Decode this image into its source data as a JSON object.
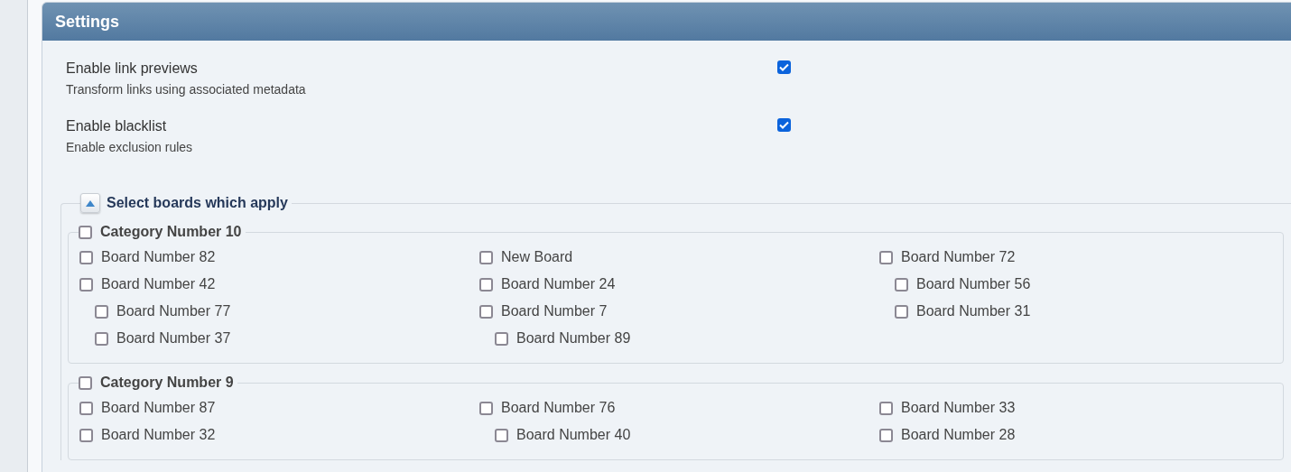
{
  "panel": {
    "title": "Settings"
  },
  "options": [
    {
      "label": "Enable link previews",
      "description": "Transform links using associated metadata",
      "checked": true
    },
    {
      "label": "Enable blacklist",
      "description": "Enable exclusion rules",
      "checked": true
    }
  ],
  "board_selector": {
    "title": "Select boards which apply",
    "expanded": true,
    "categories": [
      {
        "label": "Category Number 10",
        "checked": false,
        "columns": [
          [
            {
              "label": "Board Number 82",
              "checked": false
            },
            {
              "label": "Board Number 42",
              "checked": false,
              "children": [
                {
                  "label": "Board Number 77",
                  "checked": false
                },
                {
                  "label": "Board Number 37",
                  "checked": false
                }
              ]
            }
          ],
          [
            {
              "label": "New Board",
              "checked": false
            },
            {
              "label": "Board Number 24",
              "checked": false
            },
            {
              "label": "Board Number 7",
              "checked": false,
              "children": [
                {
                  "label": "Board Number 89",
                  "checked": false
                }
              ]
            }
          ],
          [
            {
              "label": "Board Number 72",
              "checked": false,
              "children": [
                {
                  "label": "Board Number 56",
                  "checked": false
                },
                {
                  "label": "Board Number 31",
                  "checked": false
                }
              ]
            }
          ]
        ]
      },
      {
        "label": "Category Number 9",
        "checked": false,
        "columns": [
          [
            {
              "label": "Board Number 87",
              "checked": false
            },
            {
              "label": "Board Number 32",
              "checked": false
            }
          ],
          [
            {
              "label": "Board Number 76",
              "checked": false,
              "children": [
                {
                  "label": "Board Number 40",
                  "checked": false
                }
              ]
            }
          ],
          [
            {
              "label": "Board Number 33",
              "checked": false
            },
            {
              "label": "Board Number 28",
              "checked": false
            }
          ]
        ]
      }
    ]
  }
}
